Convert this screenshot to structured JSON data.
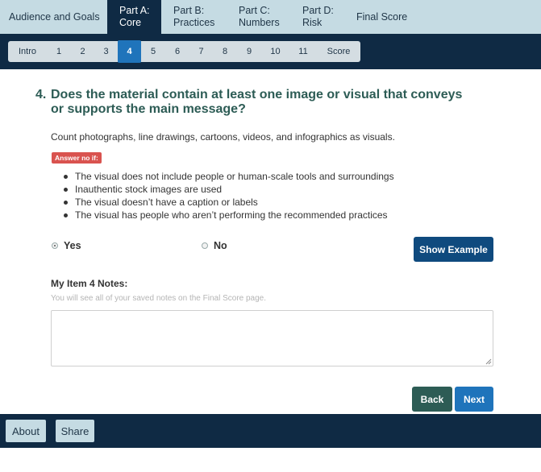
{
  "nav": {
    "tabs": [
      {
        "line1": "Audience and Goals",
        "line2": "",
        "active": false
      },
      {
        "line1": "Part A:",
        "line2": "Core",
        "active": true
      },
      {
        "line1": "Part B:",
        "line2": "Practices",
        "active": false
      },
      {
        "line1": "Part C:",
        "line2": "Numbers",
        "active": false
      },
      {
        "line1": "Part D:",
        "line2": "Risk",
        "active": false
      },
      {
        "line1": "Final Score",
        "line2": "",
        "active": false
      }
    ]
  },
  "steps": {
    "items": [
      "Intro",
      "1",
      "2",
      "3",
      "4",
      "5",
      "6",
      "7",
      "8",
      "9",
      "10",
      "11",
      "Score"
    ],
    "active": "4"
  },
  "question": {
    "number": "4.",
    "text": "Does the material contain at least one image or visual that conveys or supports the main message?",
    "hint": "Count photographs, line drawings, cartoons, videos, and infographics as visuals.",
    "badge": "Answer no if:",
    "bullets": [
      "The visual does not include people or human-scale tools and surroundings",
      "Inauthentic stock images are used",
      "The visual doesn’t have a caption or labels",
      "The visual has people who aren’t performing the recommended practices"
    ]
  },
  "answer": {
    "yes_label": "Yes",
    "no_label": "No",
    "selected": "Yes",
    "show_example_label": "Show Example"
  },
  "notes": {
    "label": "My Item 4 Notes:",
    "help": "You will see all of your saved notes on the Final Score page.",
    "value": ""
  },
  "actions": {
    "back_label": "Back",
    "next_label": "Next"
  },
  "footer": {
    "about_label": "About",
    "share_label": "Share"
  },
  "colors": {
    "nav_bg": "#c5dbe3",
    "dark_navy": "#0f2a44",
    "accent_blue": "#1f74bb",
    "question_green": "#2d5c55",
    "badge_red": "#d9534f"
  }
}
